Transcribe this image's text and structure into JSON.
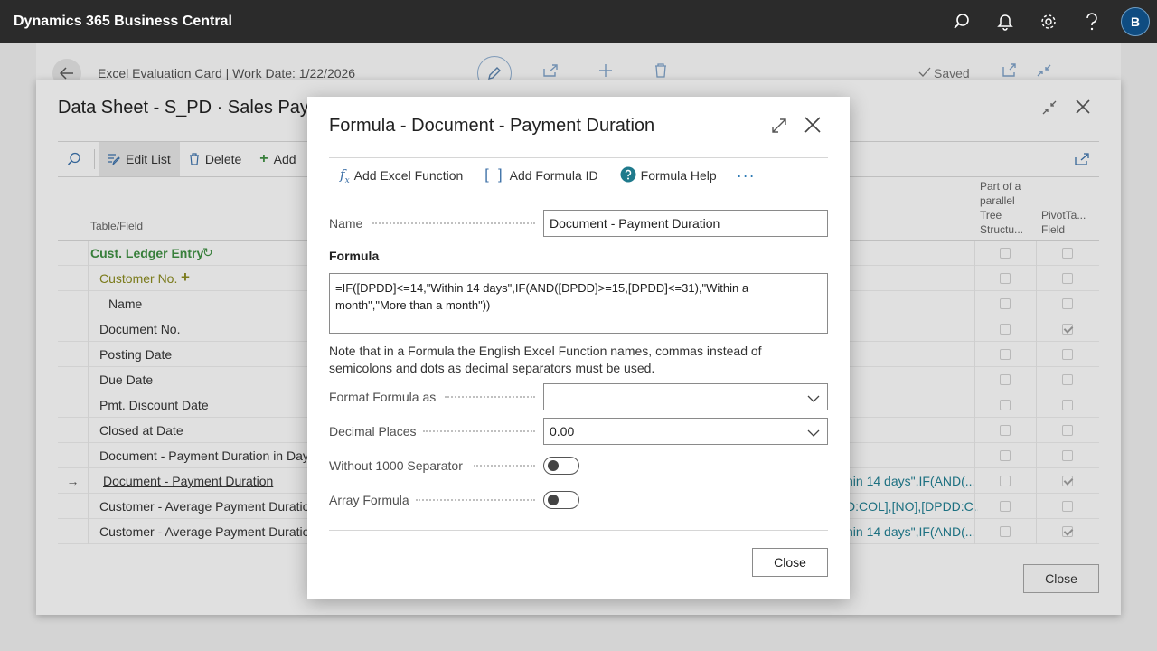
{
  "app": {
    "title": "Dynamics 365 Business Central",
    "avatar_initial": "B"
  },
  "card": {
    "title": "Excel Evaluation Card | Work Date: 1/22/2026",
    "saved_label": "Saved"
  },
  "sheet": {
    "title": "Data Sheet - S_PD · Sales Payment Duration",
    "toolbar": {
      "edit_list": "Edit List",
      "delete": "Delete",
      "add": "Add"
    },
    "columns": {
      "table_field": "Table/Field",
      "parallel_tree": "Part of a parallel Tree Structu...",
      "pivot_field": "PivotTa... Field"
    },
    "rows": [
      {
        "label": "Cust. Ledger Entry",
        "formula": "",
        "parallel": false,
        "pivot": false
      },
      {
        "label": "Customer No.",
        "formula": "",
        "parallel": false,
        "pivot": false
      },
      {
        "label": "Name",
        "formula": "",
        "parallel": false,
        "pivot": false
      },
      {
        "label": "Document No.",
        "formula": "",
        "parallel": false,
        "pivot": true
      },
      {
        "label": "Posting Date",
        "formula": "",
        "parallel": false,
        "pivot": false
      },
      {
        "label": "Due Date",
        "formula": "",
        "parallel": false,
        "pivot": false
      },
      {
        "label": "Pmt. Discount Date",
        "formula": "",
        "parallel": false,
        "pivot": false
      },
      {
        "label": "Closed at Date",
        "formula": "",
        "parallel": false,
        "pivot": false
      },
      {
        "label": "Document - Payment Duration in Days",
        "formula": "",
        "parallel": false,
        "pivot": false
      },
      {
        "label": "Document - Payment Duration",
        "formula": "hin 14 days\",IF(AND(...",
        "parallel": false,
        "pivot": true
      },
      {
        "label": "Customer - Average Payment Duration",
        "formula": "D:COL],[NO],[DPDD:C...",
        "parallel": false,
        "pivot": false
      },
      {
        "label": "Customer - Average Payment Duration",
        "formula": "hin 14 days\",IF(AND(...",
        "parallel": false,
        "pivot": true
      }
    ],
    "close_button": "Close"
  },
  "modal": {
    "title": "Formula - Document - Payment Duration",
    "toolbar": {
      "add_excel_function": "Add Excel Function",
      "add_formula_id": "Add Formula ID",
      "formula_help": "Formula Help",
      "more": "···"
    },
    "name_label": "Name",
    "name_value": "Document - Payment Duration",
    "formula_label": "Formula",
    "formula_value": "=IF([DPDD]<=14,\"Within 14 days\",IF(AND([DPDD]>=15,[DPDD]<=31),\"Within a month\",\"More than a month\"))",
    "note": "Note that in a Formula the English Excel Function names, commas instead of semicolons and dots as decimal separators must be used.",
    "format_label": "Format Formula as",
    "format_value": "",
    "decimal_label": "Decimal Places",
    "decimal_value": "0.00",
    "without_sep_label": "Without 1000 Separator",
    "without_sep_on": false,
    "array_label": "Array Formula",
    "array_on": false,
    "close_button": "Close"
  }
}
